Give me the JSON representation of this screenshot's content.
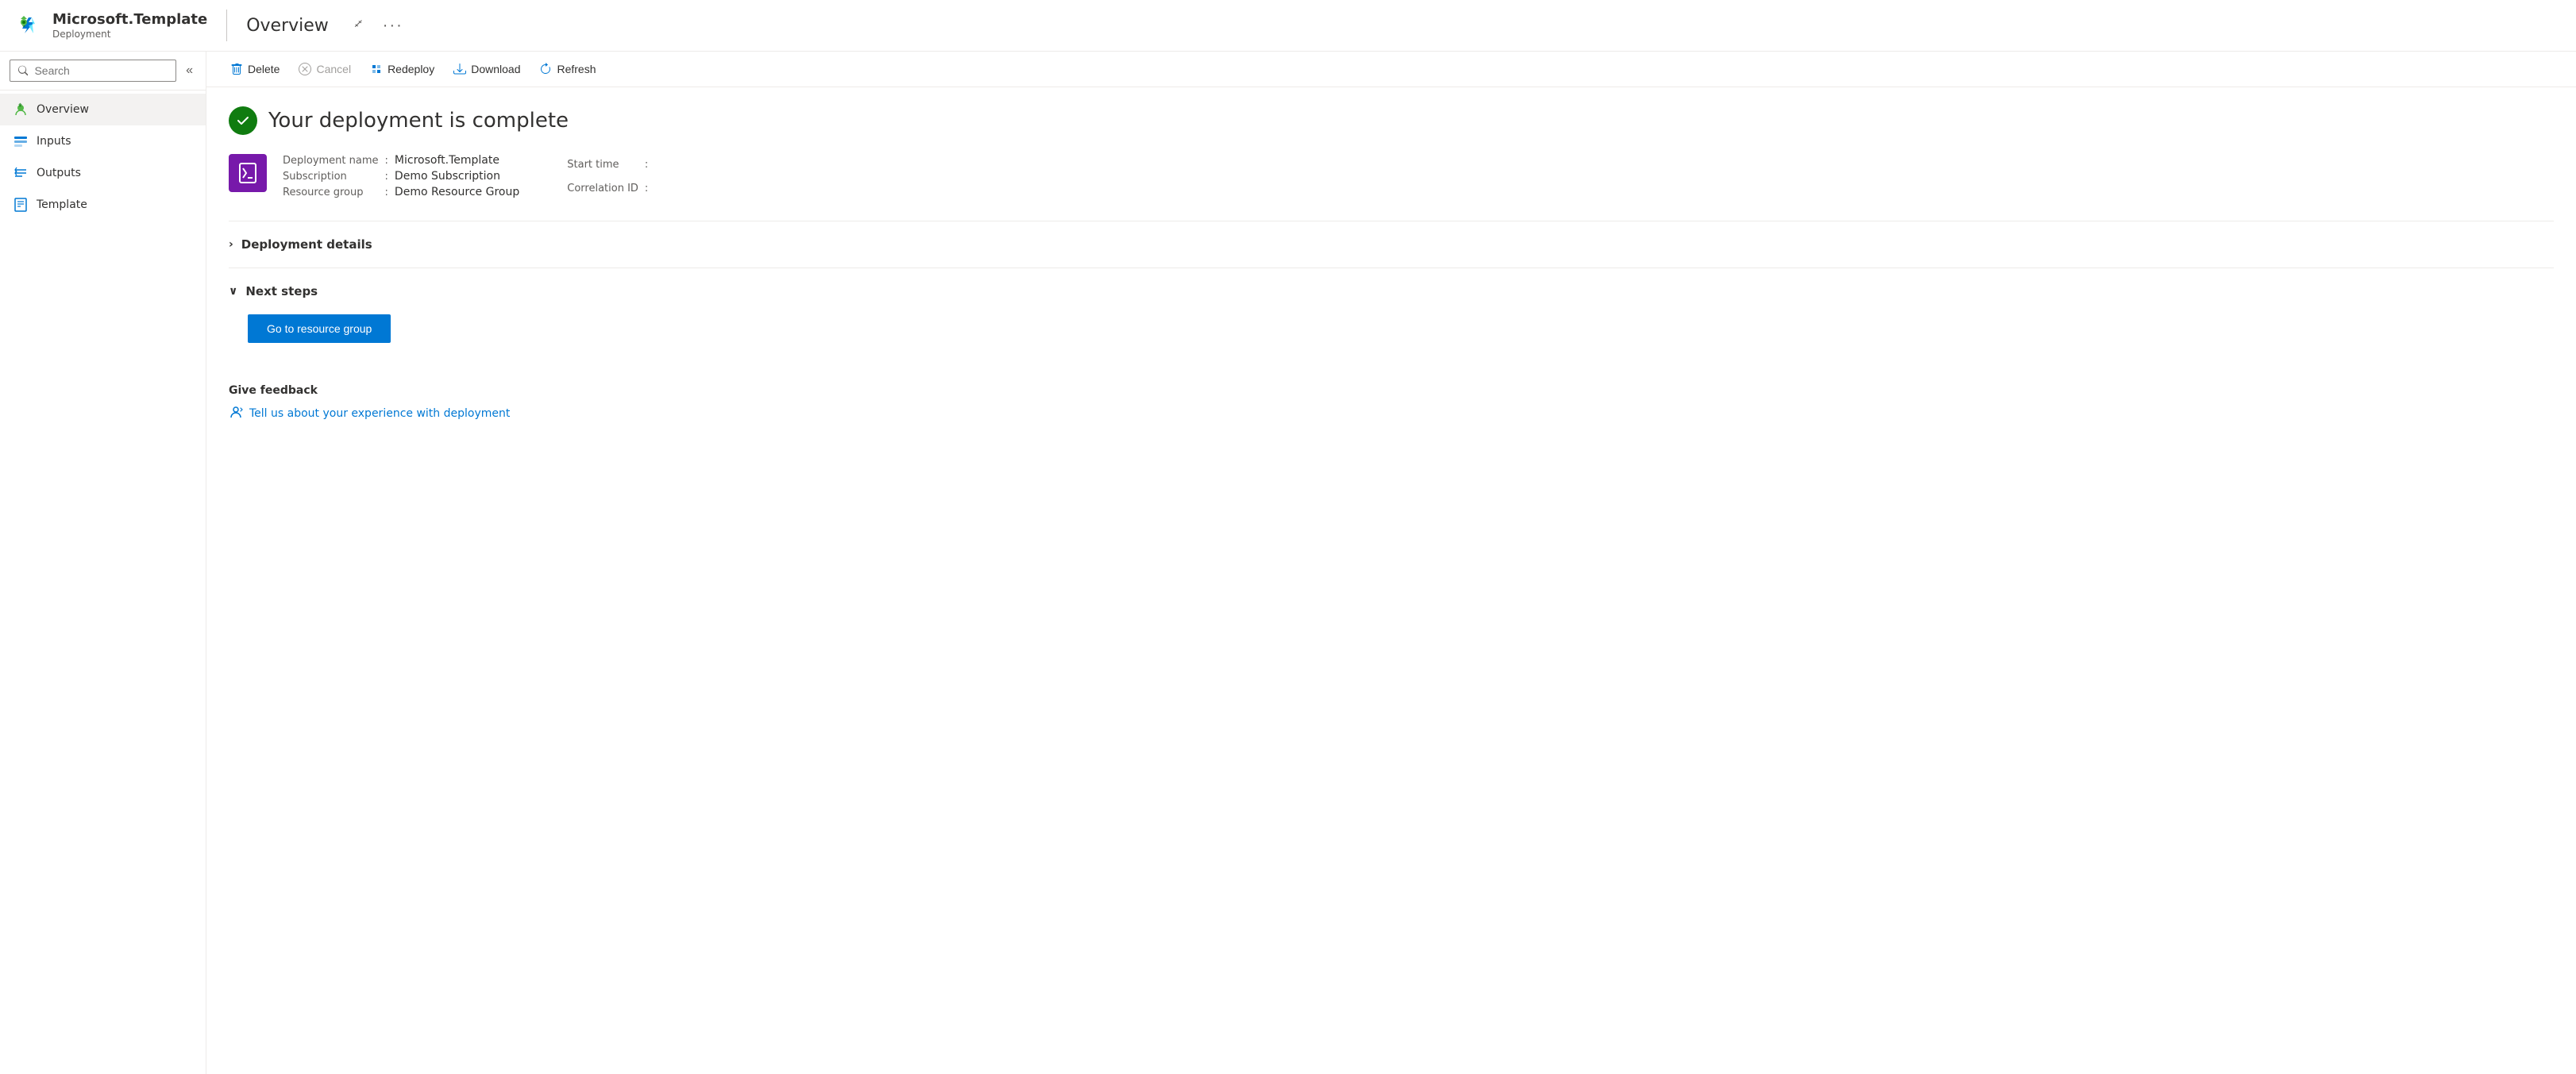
{
  "header": {
    "app_name": "Microsoft.Template",
    "app_subtitle": "Deployment",
    "page_title": "Overview",
    "pin_tooltip": "Pin",
    "more_tooltip": "More"
  },
  "sidebar": {
    "search_placeholder": "Search",
    "collapse_label": "Collapse",
    "nav_items": [
      {
        "id": "overview",
        "label": "Overview",
        "icon": "overview-icon",
        "active": true
      },
      {
        "id": "inputs",
        "label": "Inputs",
        "icon": "inputs-icon",
        "active": false
      },
      {
        "id": "outputs",
        "label": "Outputs",
        "icon": "outputs-icon",
        "active": false
      },
      {
        "id": "template",
        "label": "Template",
        "icon": "template-icon",
        "active": false
      }
    ]
  },
  "toolbar": {
    "buttons": [
      {
        "id": "delete",
        "label": "Delete",
        "icon": "delete-icon",
        "disabled": false
      },
      {
        "id": "cancel",
        "label": "Cancel",
        "icon": "cancel-icon",
        "disabled": true
      },
      {
        "id": "redeploy",
        "label": "Redeploy",
        "icon": "redeploy-icon",
        "disabled": false
      },
      {
        "id": "download",
        "label": "Download",
        "icon": "download-icon",
        "disabled": false
      },
      {
        "id": "refresh",
        "label": "Refresh",
        "icon": "refresh-icon",
        "disabled": false
      }
    ]
  },
  "main": {
    "success_message": "Your deployment is complete",
    "deployment": {
      "name_label": "Deployment name",
      "name_value": "Microsoft.Template",
      "subscription_label": "Subscription",
      "subscription_value": "Demo Subscription",
      "resource_group_label": "Resource group",
      "resource_group_value": "Demo Resource Group",
      "start_time_label": "Start time",
      "start_time_value": "",
      "correlation_id_label": "Correlation ID",
      "correlation_id_value": ""
    },
    "sections": {
      "deployment_details": {
        "title": "Deployment details",
        "expanded": false,
        "chevron": "›"
      },
      "next_steps": {
        "title": "Next steps",
        "expanded": true,
        "chevron": "∨"
      }
    },
    "go_to_resource_group_label": "Go to resource group",
    "feedback": {
      "title": "Give feedback",
      "link_label": "Tell us about your experience with deployment"
    }
  },
  "colors": {
    "primary": "#0078d4",
    "success": "#107c10",
    "purple": "#7719aa"
  }
}
